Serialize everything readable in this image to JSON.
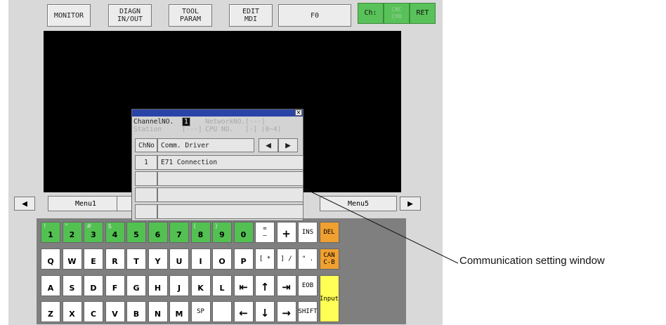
{
  "top_buttons": {
    "monitor": "MONITOR",
    "diagn": "DIAGN\nIN/OUT",
    "tool": "TOOL\nPARAM",
    "edit": "EDIT\nMDI",
    "f0": "F0"
  },
  "channel_buttons": {
    "ch": "Ch:",
    "cnc": "CNC\nCH0",
    "ret": "RET"
  },
  "menu": {
    "left_arrow": "◀",
    "right_arrow": "▶",
    "menu1": "Menu1",
    "menu5": "Menu5"
  },
  "dialog": {
    "close": "✕",
    "channel_no_label": "ChannelNO.",
    "channel_no_value": "1",
    "network_no_label": "NetworkNO.",
    "network_no_value": "[---]",
    "station_label": "Station",
    "station_value": "[---]",
    "cpu_no_label": "CPU NO.",
    "cpu_no_value": "[-] (0~4)",
    "header_chno": "ChNo",
    "header_driver": "Comm. Driver",
    "prev": "◀",
    "next": "▶",
    "rows": [
      {
        "chno": "1",
        "driver": "E71 Connection"
      },
      {
        "chno": "",
        "driver": ""
      },
      {
        "chno": "",
        "driver": ""
      },
      {
        "chno": "",
        "driver": ""
      }
    ]
  },
  "keyboard": {
    "row1": [
      {
        "main": "1",
        "sub": "!"
      },
      {
        "main": "2",
        "sub": "\""
      },
      {
        "main": "3",
        "sub": "#"
      },
      {
        "main": "4",
        "sub": "$"
      },
      {
        "main": "5",
        "sub": ""
      },
      {
        "main": "6",
        "sub": ""
      },
      {
        "main": "7",
        "sub": ""
      },
      {
        "main": "8",
        "sub": "("
      },
      {
        "main": "9",
        "sub": ")"
      },
      {
        "main": "0",
        "sub": ""
      }
    ],
    "row1_right": {
      "minus": "=\n–",
      "plus": "+",
      "ins": "INS",
      "del": "DEL"
    },
    "row2": [
      "Q",
      "W",
      "E",
      "R",
      "T",
      "Y",
      "U",
      "I",
      "O",
      "P"
    ],
    "row2_right": {
      "star": "[ *",
      "slash": "] /",
      "dot": "\" .",
      "can": "CAN\nC-B"
    },
    "row3": [
      "A",
      "S",
      "D",
      "F",
      "G",
      "H",
      "J",
      "K",
      "L"
    ],
    "row3_right": {
      "home": "⇤",
      "up": "↑",
      "end": "⇥",
      "eob": "EOB",
      "input": "Input"
    },
    "row4": [
      "Z",
      "X",
      "C",
      "V",
      "B",
      "N",
      "M"
    ],
    "row4_right": {
      "sp": "SP",
      "left": "←",
      "down": "↓",
      "right": "→",
      "shift": "SHIFT"
    }
  },
  "callout": {
    "label": "Communication setting window"
  },
  "colors": {
    "green": "#52c152",
    "orange": "#f0a030",
    "yellow": "#ffff55",
    "titlebar": "#2a43a6"
  }
}
